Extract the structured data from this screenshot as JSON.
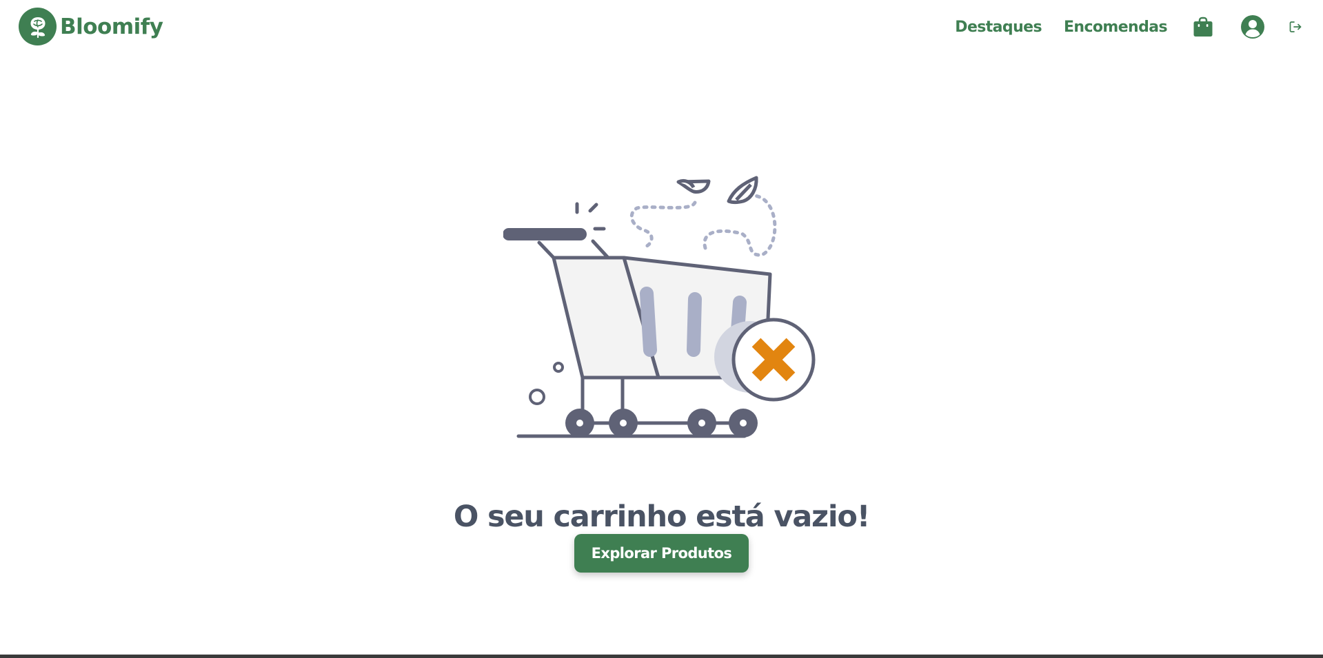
{
  "colors": {
    "brand": "#3f7f52",
    "title": "#4a5364",
    "illustration_stroke": "#5f6276",
    "illustration_accent": "#a9afc7",
    "x_badge": "#e28510"
  },
  "navbar": {
    "brand_name": "Bloomify",
    "brand_icon": "rose-logo-icon",
    "links": [
      {
        "label": "Destaques"
      },
      {
        "label": "Encomendas"
      }
    ],
    "icons": [
      "shopping-bag-icon",
      "user-account-icon",
      "logout-icon"
    ]
  },
  "empty_cart": {
    "illustration": "empty-shopping-cart-illustration",
    "title": "O seu carrinho está vazio!",
    "button_label": "Explorar Produtos"
  }
}
